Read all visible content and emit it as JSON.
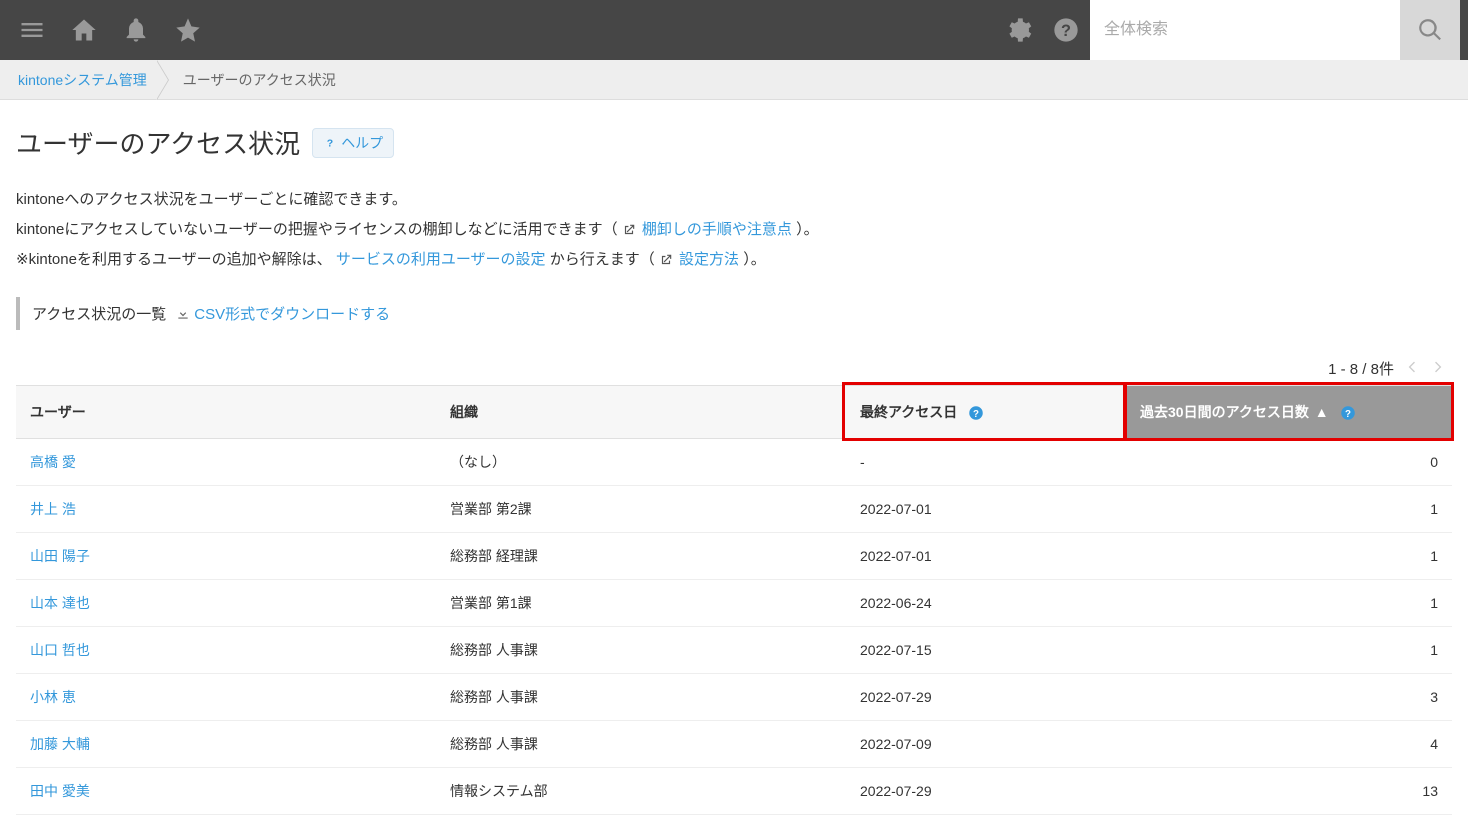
{
  "topbar": {
    "search_placeholder": "全体検索"
  },
  "breadcrumb": {
    "root": "kintoneシステム管理",
    "current": "ユーザーのアクセス状況"
  },
  "title": "ユーザーのアクセス状況",
  "help_label": "ヘルプ",
  "desc": {
    "line1": "kintoneへのアクセス状況をユーザーごとに確認できます。",
    "line2_a": "kintoneにアクセスしていないユーザーの把握やライセンスの棚卸しなどに活用できます（",
    "line2_link": "棚卸しの手順や注意点",
    "line2_b": "）。",
    "line3_a": "※kintoneを利用するユーザーの追加や解除は、",
    "line3_link1": "サービスの利用ユーザーの設定",
    "line3_mid": "から行えます（",
    "line3_link2": "設定方法",
    "line3_b": "）。"
  },
  "section": {
    "title": "アクセス状況の一覧",
    "download": "CSV形式でダウンロードする"
  },
  "pager": "1 - 8 / 8件",
  "columns": {
    "user": "ユーザー",
    "org": "組織",
    "last": "最終アクセス日",
    "days": "過去30日間のアクセス日数"
  },
  "rows": [
    {
      "user": "高橋 愛",
      "org": "（なし）",
      "last": "-",
      "days": "0"
    },
    {
      "user": "井上 浩",
      "org": "営業部 第2課",
      "last": "2022-07-01",
      "days": "1"
    },
    {
      "user": "山田 陽子",
      "org": "総務部 経理課",
      "last": "2022-07-01",
      "days": "1"
    },
    {
      "user": "山本 達也",
      "org": "営業部 第1課",
      "last": "2022-06-24",
      "days": "1"
    },
    {
      "user": "山口 哲也",
      "org": "総務部 人事課",
      "last": "2022-07-15",
      "days": "1"
    },
    {
      "user": "小林 恵",
      "org": "総務部 人事課",
      "last": "2022-07-29",
      "days": "3"
    },
    {
      "user": "加藤 大輔",
      "org": "総務部 人事課",
      "last": "2022-07-09",
      "days": "4"
    },
    {
      "user": "田中 愛美",
      "org": "情報システム部",
      "last": "2022-07-29",
      "days": "13"
    }
  ]
}
